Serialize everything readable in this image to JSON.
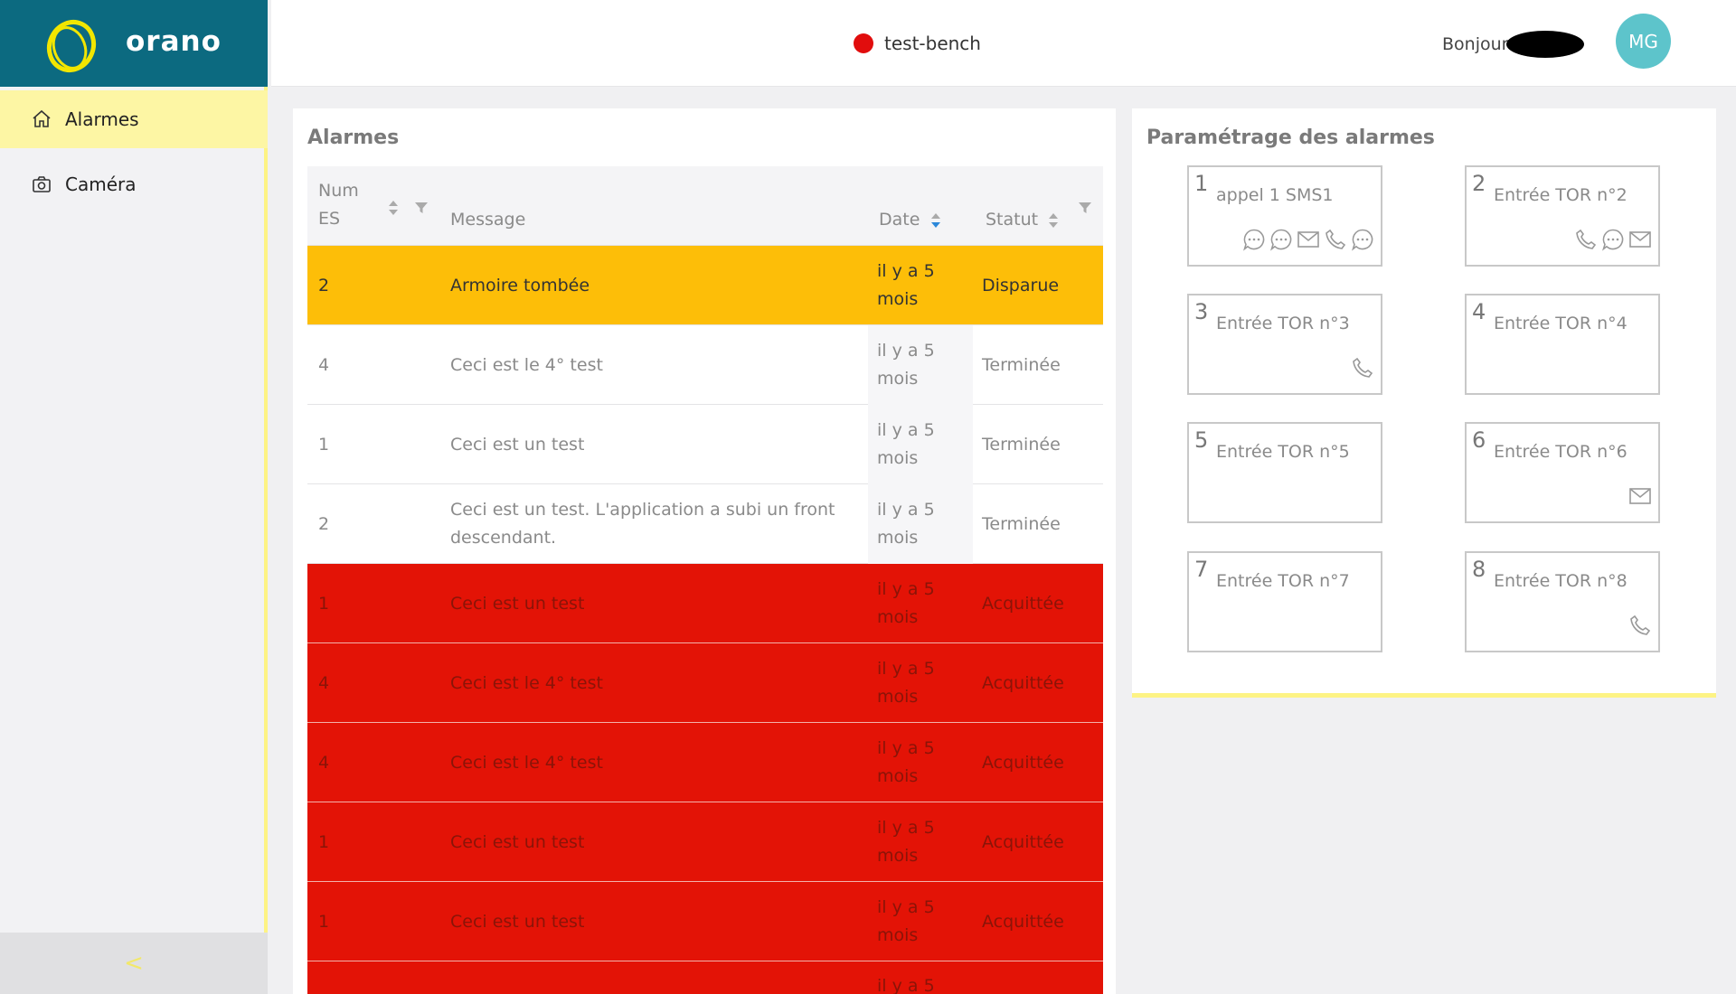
{
  "brand": {
    "name": "orano"
  },
  "sidebar": {
    "items": [
      {
        "label": "Alarmes",
        "icon": "home-icon",
        "active": true
      },
      {
        "label": "Caméra",
        "icon": "camera-icon",
        "active": false
      }
    ],
    "collapse_icon": "<"
  },
  "header": {
    "device_name": "test-bench",
    "device_status_color": "#e10d0d",
    "greeting": "Bonjour",
    "avatar_initials": "MG"
  },
  "alarms": {
    "title": "Alarmes",
    "columns": {
      "num": "Num\nES",
      "message": "Message",
      "date": "Date",
      "status": "Statut"
    },
    "rows": [
      {
        "num": "2",
        "message": "Armoire tombée",
        "date": "il y a 5 mois",
        "status": "Disparue",
        "kind": "disparue"
      },
      {
        "num": "4",
        "message": "Ceci est le 4° test",
        "date": "il y a 5 mois",
        "status": "Terminée",
        "kind": "terminee"
      },
      {
        "num": "1",
        "message": "Ceci est un test",
        "date": "il y a 5 mois",
        "status": "Terminée",
        "kind": "terminee"
      },
      {
        "num": "2",
        "message": "Ceci est un test. L'application a subi un front descendant.",
        "date": "il y a 5 mois",
        "status": "Terminée",
        "kind": "terminee"
      },
      {
        "num": "1",
        "message": "Ceci est un test",
        "date": "il y a 5 mois",
        "status": "Acquittée",
        "kind": "acquittee"
      },
      {
        "num": "4",
        "message": "Ceci est le 4° test",
        "date": "il y a 5 mois",
        "status": "Acquittée",
        "kind": "acquittee"
      },
      {
        "num": "4",
        "message": "Ceci est le 4° test",
        "date": "il y a 5 mois",
        "status": "Acquittée",
        "kind": "acquittee"
      },
      {
        "num": "1",
        "message": "Ceci est un test",
        "date": "il y a 5 mois",
        "status": "Acquittée",
        "kind": "acquittee"
      },
      {
        "num": "1",
        "message": "Ceci est un test",
        "date": "il y a 5 mois",
        "status": "Acquittée",
        "kind": "acquittee"
      },
      {
        "num": "",
        "message": "",
        "date": "il y a 5",
        "status": "",
        "kind": "acquittee"
      }
    ]
  },
  "settings": {
    "title": "Paramétrage des alarmes",
    "inputs": [
      {
        "num": "1",
        "label": "appel 1 SMS1",
        "icons": [
          "chat-icon",
          "chat-icon",
          "mail-icon",
          "phone-icon",
          "chat-icon"
        ]
      },
      {
        "num": "2",
        "label": "Entrée TOR n°2",
        "icons": [
          "phone-icon",
          "chat-icon",
          "mail-icon"
        ]
      },
      {
        "num": "3",
        "label": "Entrée TOR n°3",
        "icons": [
          "phone-icon"
        ]
      },
      {
        "num": "4",
        "label": "Entrée TOR n°4",
        "icons": []
      },
      {
        "num": "5",
        "label": "Entrée TOR n°5",
        "icons": []
      },
      {
        "num": "6",
        "label": "Entrée TOR n°6",
        "icons": [
          "mail-icon"
        ]
      },
      {
        "num": "7",
        "label": "Entrée TOR n°7",
        "icons": []
      },
      {
        "num": "8",
        "label": "Entrée TOR n°8",
        "icons": [
          "phone-icon"
        ]
      }
    ]
  }
}
